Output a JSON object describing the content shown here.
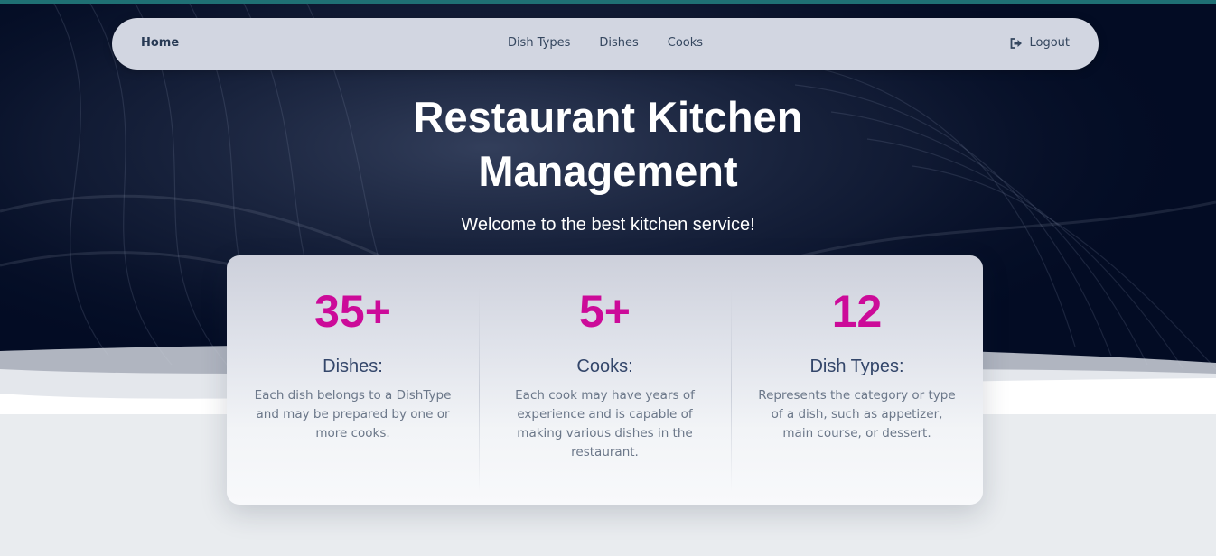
{
  "nav": {
    "home": "Home",
    "links": [
      "Dish Types",
      "Dishes",
      "Cooks"
    ],
    "logout": "Logout",
    "logout_icon": "sign-out-icon"
  },
  "hero": {
    "title": "Restaurant Kitchen Management",
    "subtitle": "Welcome to the best kitchen service!"
  },
  "stats": [
    {
      "number": "35+",
      "label": "Dishes:",
      "description": "Each dish belongs to a DishType and may be prepared by one or more cooks."
    },
    {
      "number": "5+",
      "label": "Cooks:",
      "description": "Each cook may have years of experience and is capable of making various dishes in the restaurant."
    },
    {
      "number": "12",
      "label": "Dish Types:",
      "description": "Represents the category or type of a dish, such as appetizer, main course, or dessert."
    }
  ],
  "colors": {
    "accent": "#cc0b99",
    "hero_bg": "#030c24",
    "navbar_bg": "#d2d6e1",
    "top_border": "#1f7074",
    "page_bg": "#e9ecef"
  }
}
